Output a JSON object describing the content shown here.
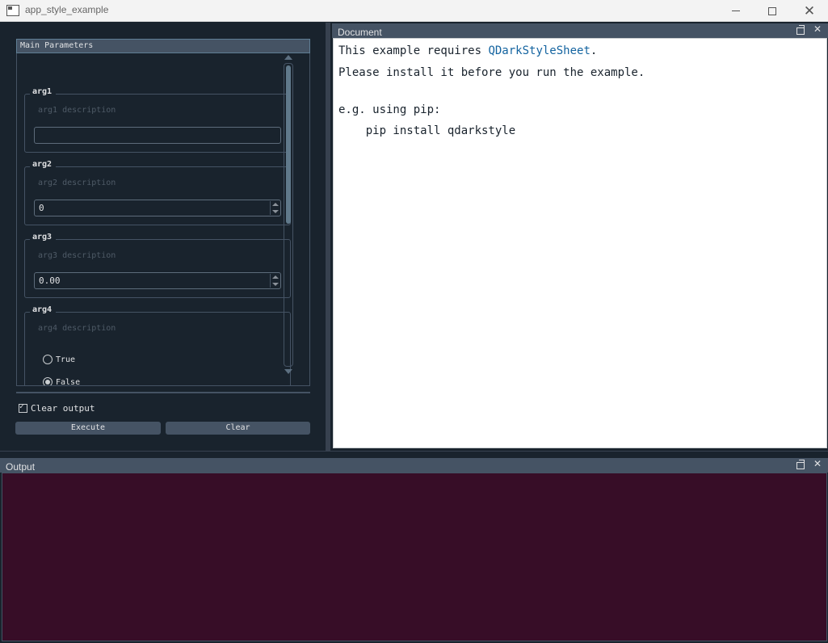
{
  "window": {
    "title": "app_style_example"
  },
  "main_parameters": {
    "header": "Main Parameters",
    "args": [
      {
        "label": "arg1",
        "description": "arg1 description",
        "value": ""
      },
      {
        "label": "arg2",
        "description": "arg2 description",
        "value": "0"
      },
      {
        "label": "arg3",
        "description": "arg3 description",
        "value": "0.00"
      },
      {
        "label": "arg4",
        "description": "arg4 description",
        "options": [
          "True",
          "False"
        ],
        "selected": "False"
      }
    ],
    "clear_output_label": "Clear output",
    "clear_output_checked": true,
    "execute_label": "Execute",
    "clear_label": "Clear"
  },
  "document_dock": {
    "title": "Document",
    "text_prefix": "This example requires ",
    "link_text": "QDarkStyleSheet",
    "text_suffix": ".",
    "line2": "Please install it before you run the example.",
    "line3": "e.g. using pip:",
    "line4": "    pip install qdarkstyle"
  },
  "output_dock": {
    "title": "Output"
  },
  "icons": {
    "app": "app-window-icon",
    "minimize": "minimize-icon",
    "maximize": "maximize-icon",
    "close": "close-icon",
    "float": "float-icon"
  },
  "colors": {
    "background": "#19232d",
    "panel_header": "#455364",
    "output_bg": "#370d27",
    "link": "#1464a0"
  }
}
